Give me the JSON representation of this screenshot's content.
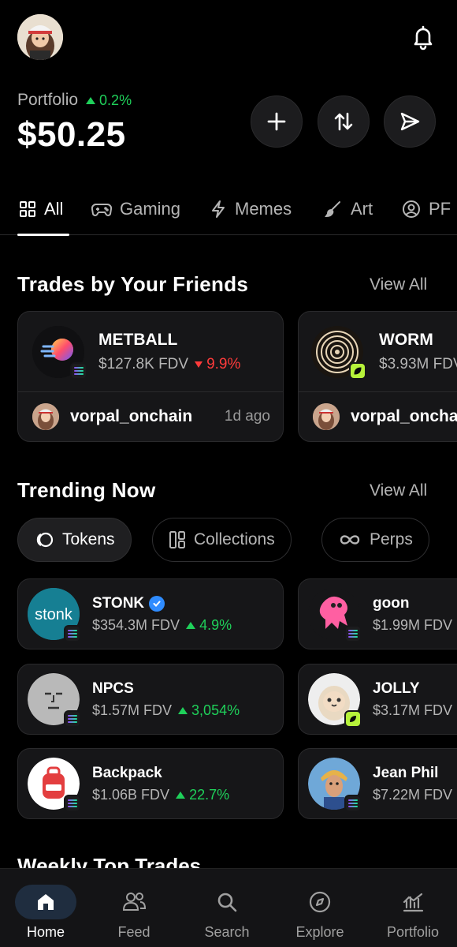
{
  "header": {
    "portfolio_label": "Portfolio",
    "portfolio_change": "0.2%",
    "balance": "$50.25"
  },
  "actions": [
    "add",
    "swap",
    "send"
  ],
  "category_tabs": [
    {
      "label": "All",
      "icon": "grid-icon",
      "active": true
    },
    {
      "label": "Gaming",
      "icon": "gamepad-icon"
    },
    {
      "label": "Memes",
      "icon": "lightning-icon"
    },
    {
      "label": "Art",
      "icon": "brush-icon"
    },
    {
      "label": "PF",
      "icon": "profile-icon"
    }
  ],
  "friends_section": {
    "title": "Trades by Your Friends",
    "view_all": "View All",
    "cards": [
      {
        "name": "METBALL",
        "fdv": "$127.8K FDV",
        "change": "9.9%",
        "direction": "down",
        "user": "vorpal_onchain",
        "time": "1d ago"
      },
      {
        "name": "WORM",
        "fdv": "$3.93M FDV",
        "user": "vorpal_onchain"
      }
    ]
  },
  "trending_section": {
    "title": "Trending Now",
    "view_all": "View All",
    "chips": [
      {
        "label": "Tokens",
        "active": true
      },
      {
        "label": "Collections"
      },
      {
        "label": "Perps"
      }
    ],
    "tokens": [
      {
        "name": "STONK",
        "verified": true,
        "fdv": "$354.3M FDV",
        "change": "4.9%",
        "image_text": "stonk"
      },
      {
        "name": "goon",
        "fdv": "$1.99M FDV"
      },
      {
        "name": "NPCS",
        "fdv": "$1.57M FDV",
        "change": "3,054%"
      },
      {
        "name": "JOLLY",
        "fdv": "$3.17M FDV"
      },
      {
        "name": "Backpack",
        "fdv": "$1.06B FDV",
        "change": "22.7%"
      },
      {
        "name": "Jean Phil",
        "fdv": "$7.22M FDV"
      }
    ]
  },
  "next_section_title": "Weekly Top Trades",
  "bottom_nav": [
    {
      "label": "Home",
      "icon": "home-icon",
      "active": true
    },
    {
      "label": "Feed",
      "icon": "people-icon"
    },
    {
      "label": "Search",
      "icon": "search-icon"
    },
    {
      "label": "Explore",
      "icon": "compass-icon"
    },
    {
      "label": "Portfolio",
      "icon": "chart-icon"
    }
  ],
  "colors": {
    "up": "#1fd05a",
    "down": "#ff3b3b",
    "background": "#000000",
    "card": "#161618",
    "verified": "#2f8cff",
    "nav_active": "#1f2d3f"
  }
}
